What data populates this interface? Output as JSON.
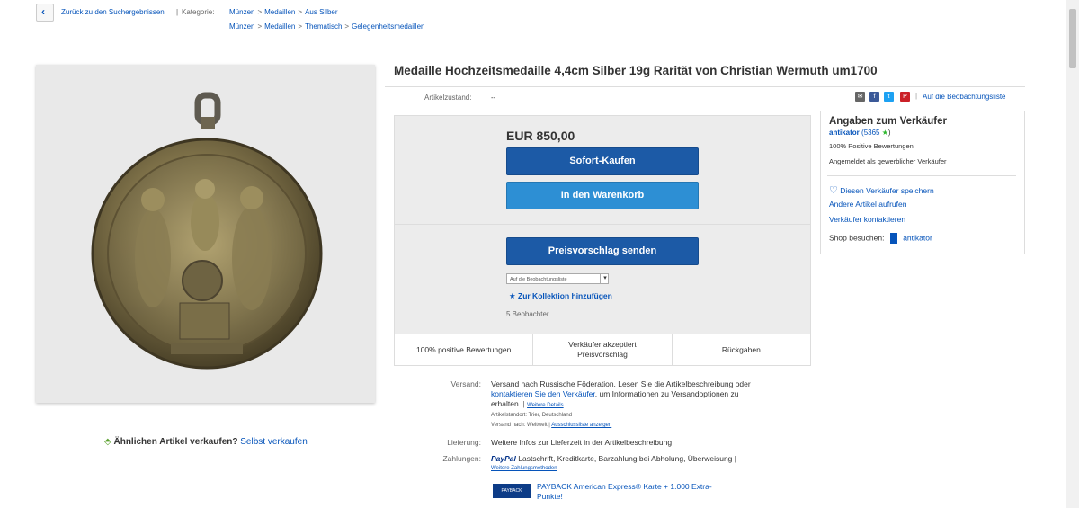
{
  "breadcrumb": {
    "back_label": "Zurück zu den Suchergebnissen",
    "category_label": "Kategorie:",
    "row1": [
      "Münzen",
      "Medaillen",
      "Aus Silber"
    ],
    "row2": [
      "Münzen",
      "Medaillen",
      "Thematisch",
      "Gelegenheitsmedaillen"
    ]
  },
  "listing": {
    "title": "Medaille Hochzeitsmedaille 4,4cm Silber 19g Rarität von Christian Wermuth um1700",
    "condition_label": "Artikelzustand:",
    "condition_value": "--",
    "watchlist_link": "Auf die Beobachtungsliste",
    "share_icons": [
      "mail-icon",
      "facebook-icon",
      "twitter-icon",
      "pinterest-icon"
    ]
  },
  "sell_similar": {
    "question": "Ähnlichen Artikel verkaufen?",
    "link": "Selbst verkaufen"
  },
  "buybox": {
    "price": "EUR 850,00",
    "buy_now": "Sofort-Kaufen",
    "add_to_cart": "In den Warenkorb",
    "make_offer": "Preisvorschlag senden",
    "watch_select": "Auf die Beobachtungsliste",
    "add_collection": "Zur Kollektion hinzufügen",
    "watchers": "5 Beobachter",
    "features": [
      "100% positive Bewertungen",
      "Verkäufer akzeptiert Preisvorschlag",
      "Rückgaben"
    ]
  },
  "seller": {
    "heading": "Angaben zum Verkäufer",
    "name": "antikator",
    "score": "(5365",
    "score_close": ")",
    "positive": "100% Positive Bewertungen",
    "commercial": "Angemeldet als gewerblicher Verkäufer",
    "save_seller": "Diesen Verkäufer speichern",
    "other_items": "Andere Artikel aufrufen",
    "contact": "Verkäufer kontaktieren",
    "shop_label": "Shop besuchen:",
    "shop_name": "antikator"
  },
  "shipping": {
    "label": "Versand:",
    "line1_a": "Versand nach Russische Föderation. Lesen Sie die Artikelbeschreibung oder",
    "line2_link": "kontaktieren Sie den Verkäufer",
    "line2_b": ", um Informationen zu Versandoptionen zu",
    "line3_a": "erhalten.",
    "details_link": "Weitere Details",
    "location_label": "Artikelstandort:",
    "location": "Trier, Deutschland",
    "ships_to_label": "Versand nach:",
    "ships_to": "Weltweit",
    "exclusions_link": "Ausschlussliste anzeigen"
  },
  "delivery": {
    "label": "Lieferung:",
    "value": "Weitere Infos zur Lieferzeit in der Artikelbeschreibung"
  },
  "payment": {
    "label": "Zahlungen:",
    "paypal": "PayPal",
    "methods": "Lastschrift,  Kreditkarte,  Barzahlung bei Abholung,  Überweisung  |",
    "more_link": "Weitere Zahlungsmethoden",
    "payback_logo": "PAYBACK",
    "payback_text": "PAYBACK American Express® Karte + 1.000 Extra-",
    "payback_text2": "Punkte!"
  },
  "colors": {
    "link": "#0654ba",
    "primary_button": "#1c5aa6",
    "secondary_button": "#2d8fd4",
    "star": "#2eb82e"
  }
}
